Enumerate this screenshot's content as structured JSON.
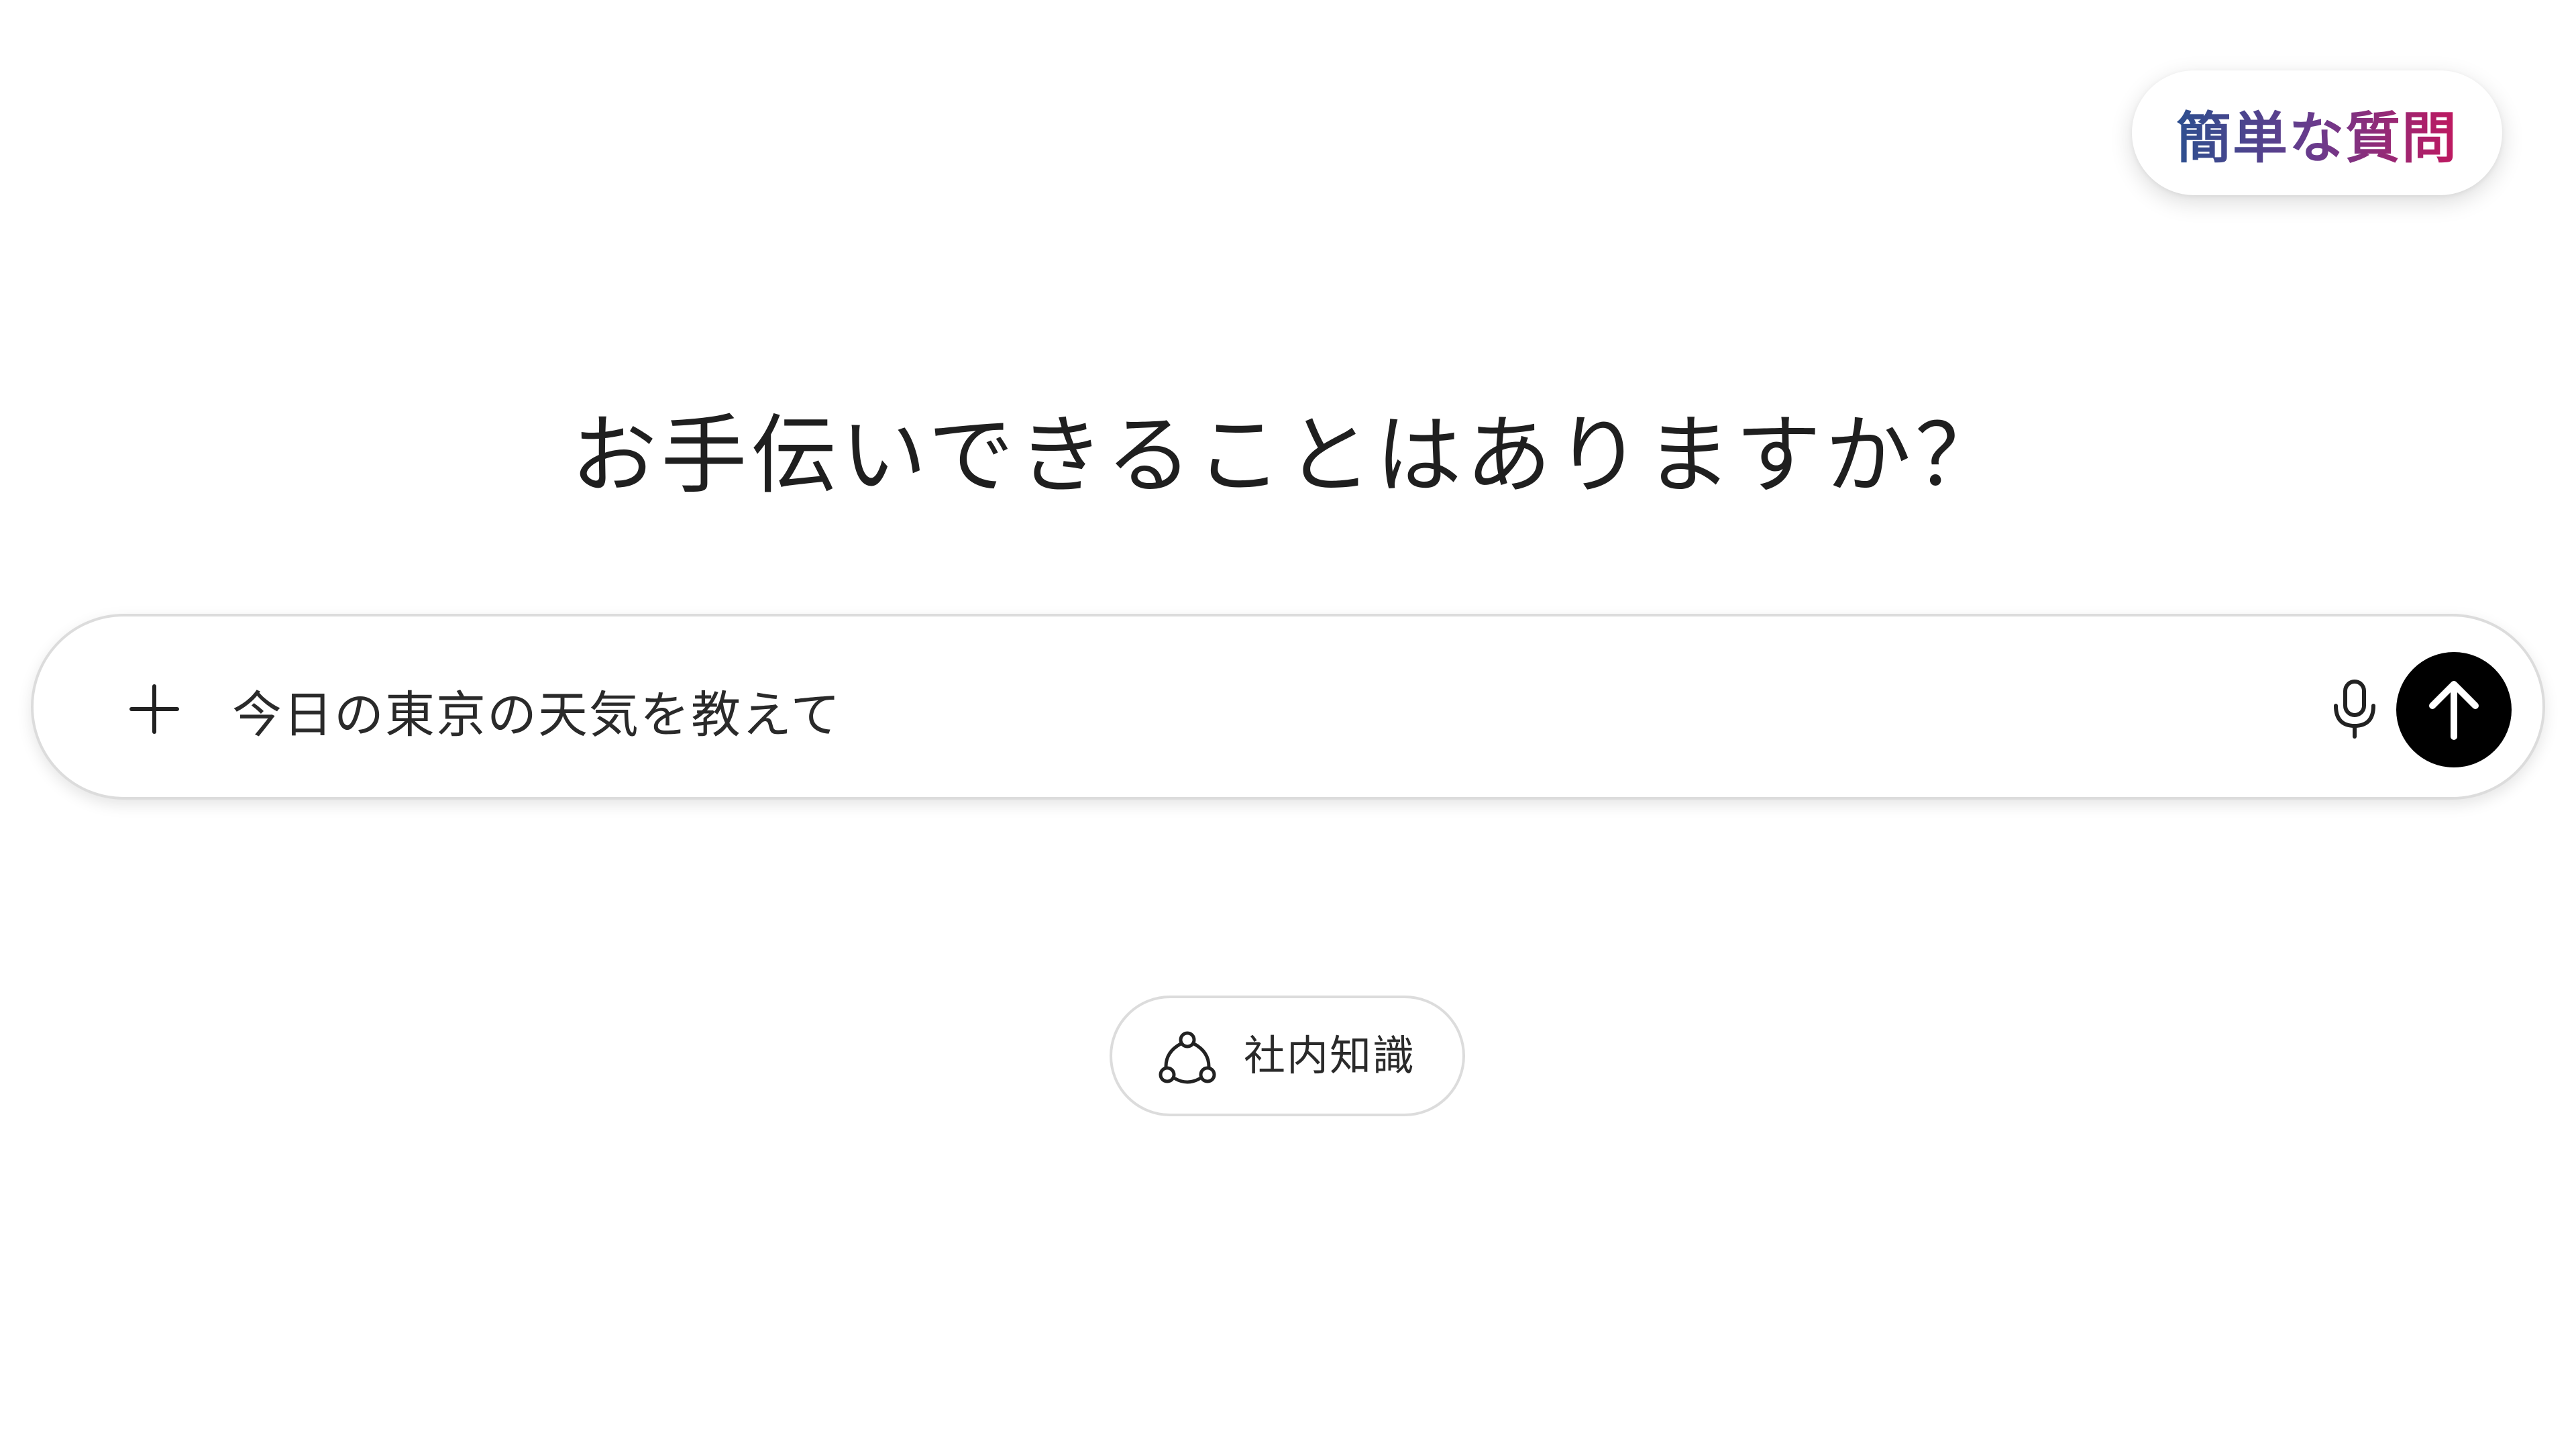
{
  "badge": {
    "label": "簡単な質問",
    "gradient_colors": [
      "#2d4f8f",
      "#6b3a8c",
      "#c0185f"
    ]
  },
  "greeting": {
    "text": "お手伝いできることはありますか？"
  },
  "composer": {
    "input_value": "今日の東京の天気を教えて",
    "plus_icon": "plus-icon",
    "mic_icon": "microphone-icon",
    "send_icon": "arrow-up-icon",
    "send_button_color": "#000000"
  },
  "chips": {
    "knowledge_label": "社内知識",
    "knowledge_icon": "knowledge-network-icon"
  }
}
